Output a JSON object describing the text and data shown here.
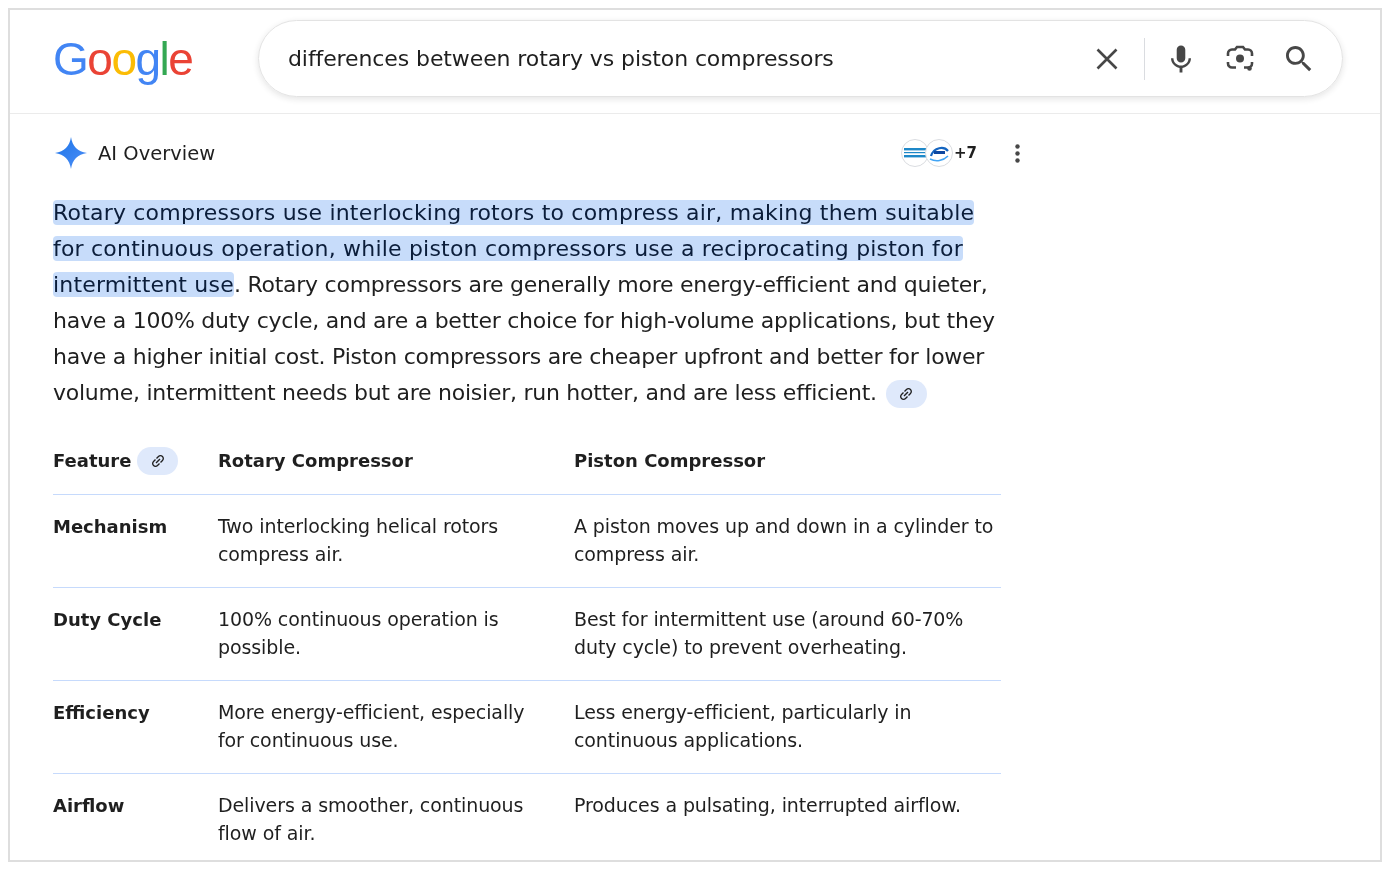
{
  "logo": "Google",
  "search": {
    "query": "differences between rotary vs piston compressors"
  },
  "ai_overview": {
    "title": "AI Overview",
    "more_sources": "+7",
    "summary": [
      {
        "text": "Rotary compressors use interlocking rotors to compress air, making them suitable for continuous operation, while piston compressors use a reciprocating piston for intermittent use",
        "highlighted": true
      },
      {
        "text": ". Rotary compressors are generally more energy-efficient and quieter, have a 100% duty cycle, and are a better choice for high-volume applications, but they have a higher initial cost. Piston compressors are cheaper upfront and better for lower volume, intermittent needs but are noisier, run hotter, and are less efficient.",
        "highlighted": false
      }
    ],
    "summary_link": true,
    "table": {
      "columns": [
        {
          "label": "Feature",
          "link": true
        },
        {
          "label": "Rotary Compressor",
          "link": false
        },
        {
          "label": "Piston Compressor",
          "link": false
        }
      ],
      "rows": [
        [
          "Mechanism",
          "Two interlocking helical rotors compress air.",
          "A piston moves up and down in a cylinder to compress air."
        ],
        [
          "Duty Cycle",
          "100% continuous operation is possible.",
          "Best for intermittent use (around 60-70% duty cycle) to prevent overheating."
        ],
        [
          "Efficiency",
          "More energy-efficient, especially for continuous use.",
          "Less energy-efficient, particularly in continuous applications."
        ],
        [
          "Airflow",
          "Delivers a smoother, continuous flow of air.",
          "Produces a pulsating, interrupted airflow."
        ]
      ]
    }
  }
}
